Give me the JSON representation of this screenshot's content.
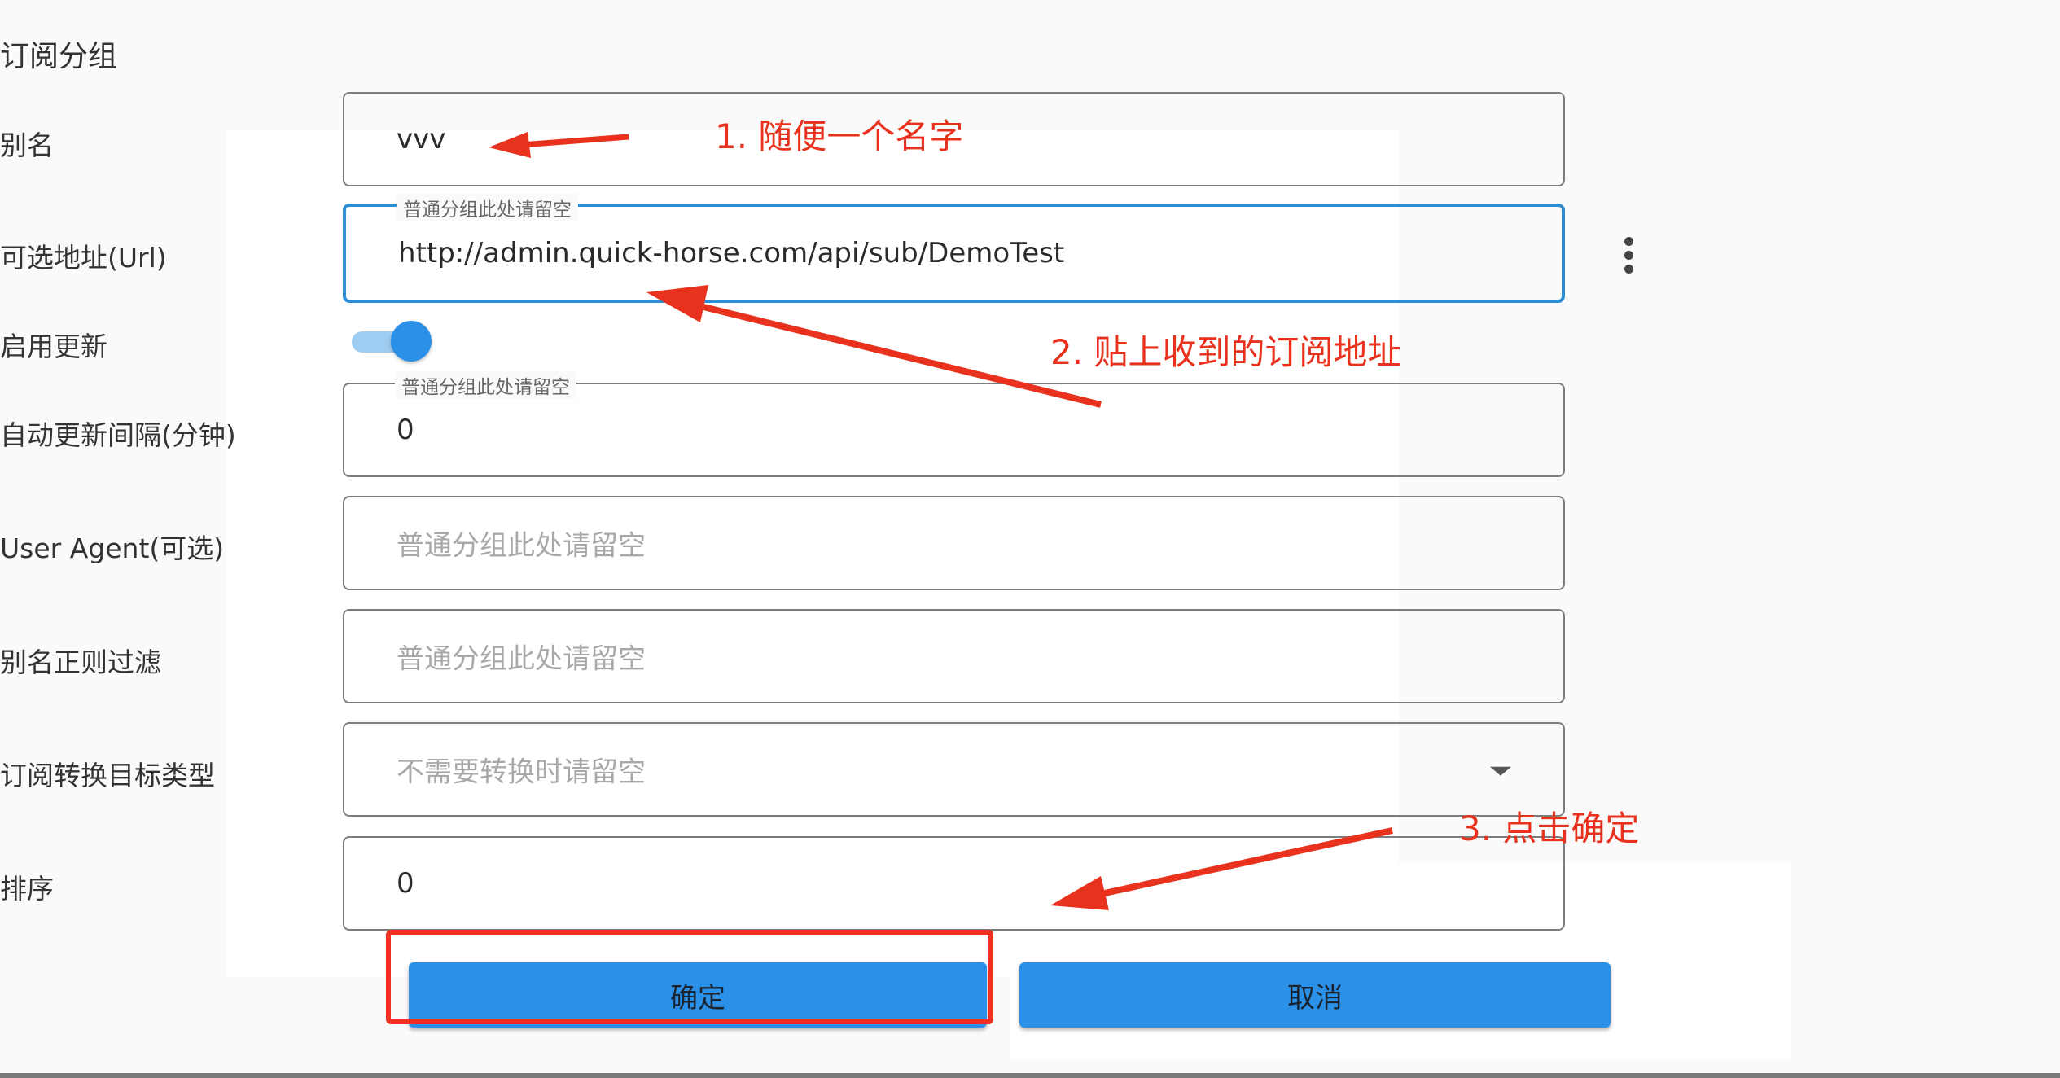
{
  "form": {
    "title": "订阅分组",
    "fields": [
      {
        "label": "别名",
        "value": "vvv"
      },
      {
        "label": "可选地址(Url)",
        "legend": "普通分组此处请留空",
        "value": "http://admin.quick-horse.com/api/sub/DemoTest"
      },
      {
        "label": "启用更新",
        "toggle_on": true
      },
      {
        "label": "自动更新间隔(分钟)",
        "legend": "普通分组此处请留空",
        "value": "0"
      },
      {
        "label": "User Agent(可选)",
        "placeholder": "普通分组此处请留空"
      },
      {
        "label": "别名正则过滤",
        "placeholder": "普通分组此处请留空"
      },
      {
        "label": "订阅转换目标类型",
        "placeholder": "不需要转换时请留空"
      },
      {
        "label": "排序",
        "value": "0"
      }
    ],
    "buttons": {
      "confirm": "确定",
      "cancel": "取消"
    }
  },
  "annotations": {
    "step1": "1. 随便一个名字",
    "step2": "2. 贴上收到的订阅地址",
    "step3": "3. 点击确定",
    "color": "#e8321e"
  },
  "colors": {
    "accent": "#2b90e8",
    "focus_border": "#2c8fd6",
    "annotation": "#e8321e"
  }
}
